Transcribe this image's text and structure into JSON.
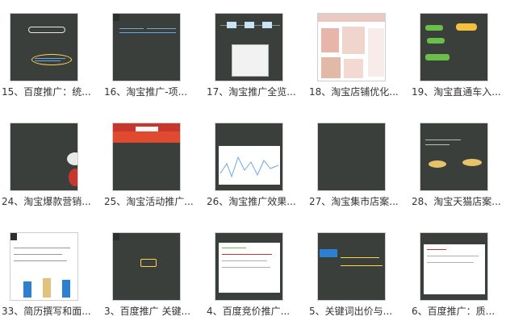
{
  "items": [
    {
      "caption": "15、百度推广：统..."
    },
    {
      "caption": "16、淘宝推广-项..."
    },
    {
      "caption": "17、淘宝推广全览..."
    },
    {
      "caption": "18、淘宝店铺优化..."
    },
    {
      "caption": "19、淘宝直通车入..."
    },
    {
      "caption": "24、淘宝爆款营销..."
    },
    {
      "caption": "25、淘宝活动推广..."
    },
    {
      "caption": "26、淘宝推广效果..."
    },
    {
      "caption": "27、淘宝集市店案..."
    },
    {
      "caption": "28、淘宝天猫店案..."
    },
    {
      "caption": "33、简历撰写和面..."
    },
    {
      "caption": "3、百度推广 关键..."
    },
    {
      "caption": "4、百度竞价推广..."
    },
    {
      "caption": "5、关键词出价与..."
    },
    {
      "caption": "6、百度推广：质..."
    }
  ],
  "colors": {
    "chalkboard": "#3b3f3c",
    "caption_text": "#333333",
    "accent_yellow": "#ffd44a",
    "accent_green": "#6abf4b",
    "accent_red": "#c8372d",
    "accent_blue": "#2d7fd1"
  }
}
